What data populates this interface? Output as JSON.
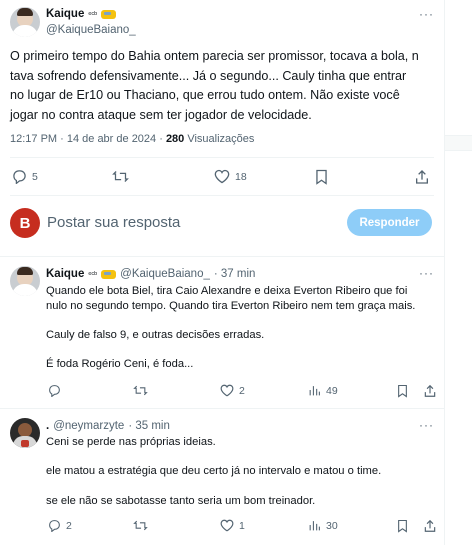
{
  "tweet": {
    "author_name": "Kaique",
    "author_badge": "ᵉᶜᵇ",
    "author_handle": "@KaiqueBaiano_",
    "more": "···",
    "lines": [
      "O primeiro tempo do Bahia ontem parecia ser promissor, tocava a bola, n",
      "tava sofrendo defensivamente... Já o segundo... Cauly tinha que entrar",
      "no lugar de Er10 ou Thaciano, que errou tudo ontem. Não existe você",
      "jogar no contra ataque sem ter jogador de velocidade."
    ],
    "time": "12:17 PM · 14 de abr de 2024 · ",
    "views_count": "280",
    "views_label": " Visualizações",
    "actions": {
      "replies": "5",
      "retweets": "",
      "likes": "18"
    }
  },
  "composer": {
    "avatar_letter": "B",
    "placeholder": "Postar sua resposta",
    "button_label": "Responder",
    "button_color": "#8ecdf8"
  },
  "replies": [
    {
      "author_name": "Kaique",
      "author_badge": "ᵉᶜᵇ",
      "author_handle": "@KaiqueBaiano_",
      "time": "· 37 min",
      "more": "···",
      "lines": [
        "Quando ele bota Biel, tira Caio Alexandre e deixa Everton Ribeiro que foi",
        "nulo no segundo tempo. Quando tira Everton Ribeiro nem tem graça mais.",
        "",
        "Cauly de falso 9, e outras decisões erradas.",
        "",
        "É foda Rogério Ceni, é foda..."
      ],
      "actions": {
        "replies": "",
        "retweets": "",
        "likes": "2",
        "views": "49"
      }
    },
    {
      "author_name": ".",
      "author_handle": "@neymarzyte",
      "time": "· 35 min",
      "more": "···",
      "lines": [
        "Ceni se perde nas próprias ideias.",
        "",
        "ele matou a estratégia que deu certo já no intervalo e matou o time.",
        "",
        "se ele não se sabotasse tanto seria um bom treinador."
      ],
      "actions": {
        "replies": "2",
        "retweets": "",
        "likes": "1",
        "views": "30"
      }
    }
  ],
  "colors": {
    "accent": "#1d9bf0",
    "muted": "#536471",
    "text": "#0f1419",
    "divider": "#eff3f4"
  }
}
